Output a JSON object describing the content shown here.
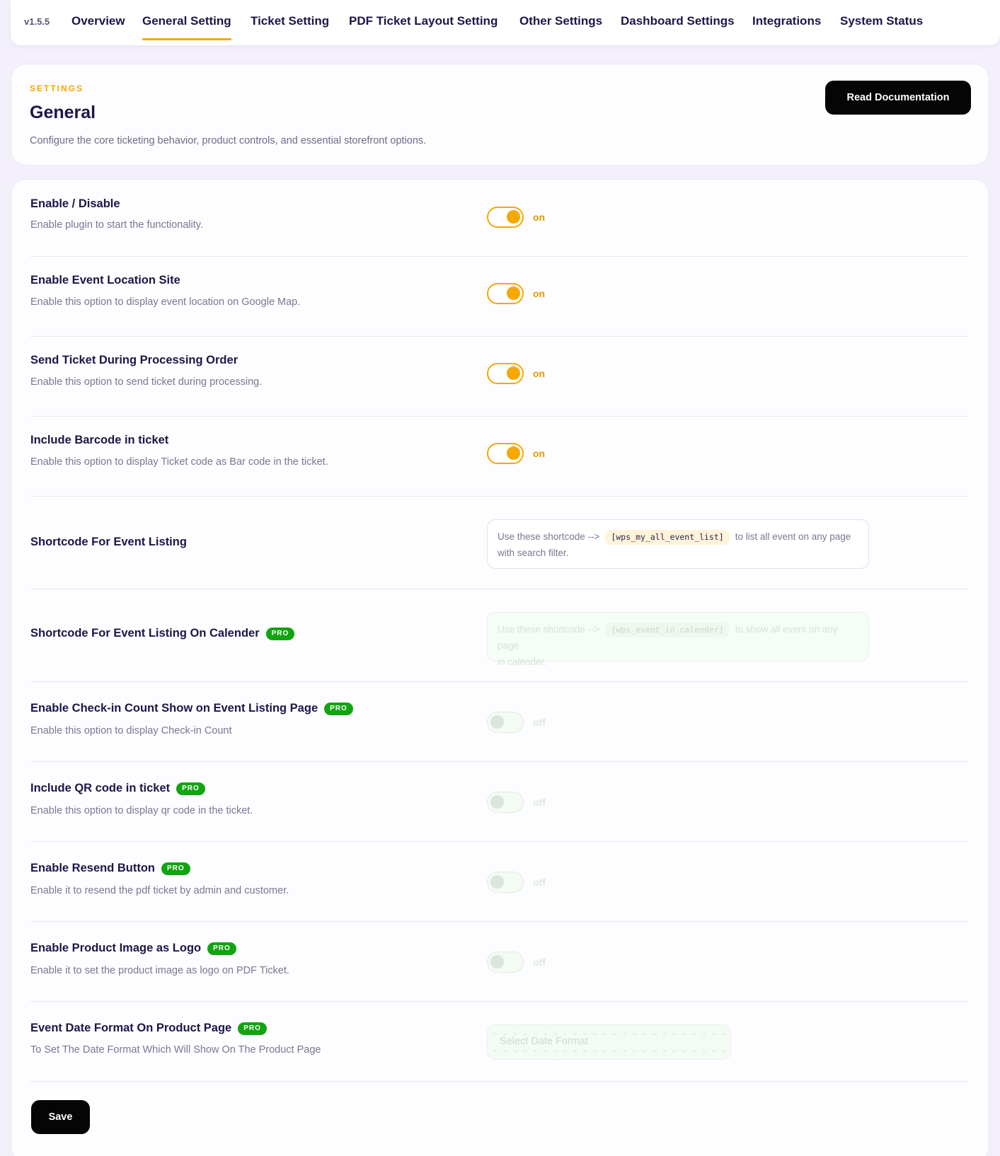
{
  "nav": {
    "version": "v1.5.5",
    "tabs": [
      {
        "label": "Overview"
      },
      {
        "label": "General Setting"
      },
      {
        "label": "Ticket Setting"
      },
      {
        "label": "PDF Ticket Layout Setting"
      },
      {
        "label": "Other Settings"
      },
      {
        "label": "Dashboard Settings"
      },
      {
        "label": "Integrations"
      },
      {
        "label": "System Status"
      }
    ],
    "active_tab": "General Setting"
  },
  "header": {
    "eyebrow": "SETTINGS",
    "title": "General",
    "description": "Configure the core ticketing behavior, product controls, and essential storefront options.",
    "doc_button": "Read Documentation"
  },
  "pro_badge": "PRO",
  "settings": {
    "enable_disable": {
      "title": "Enable / Disable",
      "desc": "Enable plugin to start the functionality.",
      "state": "on"
    },
    "event_location": {
      "title": "Enable Event Location Site",
      "desc": "Enable this option to display event location on Google Map.",
      "state": "on"
    },
    "send_ticket": {
      "title": "Send Ticket During Processing Order",
      "desc": "Enable this option to send ticket during processing.",
      "state": "on"
    },
    "barcode": {
      "title": "Include Barcode in ticket",
      "desc": "Enable this option to display Ticket code as Bar code in the ticket.",
      "state": "on"
    },
    "shortcode_listing": {
      "title": "Shortcode For Event Listing",
      "prefix": "Use these shortcode -->",
      "code": "[wps_my_all_event_list]",
      "suffix_1": "to list all event on any page",
      "suffix_2": "with search filter."
    },
    "shortcode_calendar": {
      "title": "Shortcode For Event Listing On Calender",
      "prefix": "Use these shortcode -->",
      "code": "[wps_event_in_calender]",
      "suffix_1": "to show all event on any page",
      "suffix_2": "in calender."
    },
    "checkin_count": {
      "title": "Enable Check-in Count Show on Event Listing Page",
      "desc": "Enable this option to display Check-in Count",
      "state": "off"
    },
    "qr_code": {
      "title": "Include QR code in ticket",
      "desc": "Enable this option to display qr code in the ticket.",
      "state": "off"
    },
    "resend_button": {
      "title": "Enable Resend Button",
      "desc": "Enable it to resend the pdf ticket by admin and customer.",
      "state": "off"
    },
    "product_image_logo": {
      "title": "Enable Product Image as Logo",
      "desc": "Enable it to set the product image as logo on PDF Ticket.",
      "state": "off"
    },
    "date_format": {
      "title": "Event Date Format On Product Page",
      "desc": "To Set The Date Format Which Will Show On The Product Page",
      "placeholder": "Select Date Format"
    }
  },
  "save_button": "Save",
  "colors": {
    "accent": "#f5a800",
    "pro": "#11a411",
    "text_dark": "#1b1747",
    "button_black": "#050505"
  }
}
